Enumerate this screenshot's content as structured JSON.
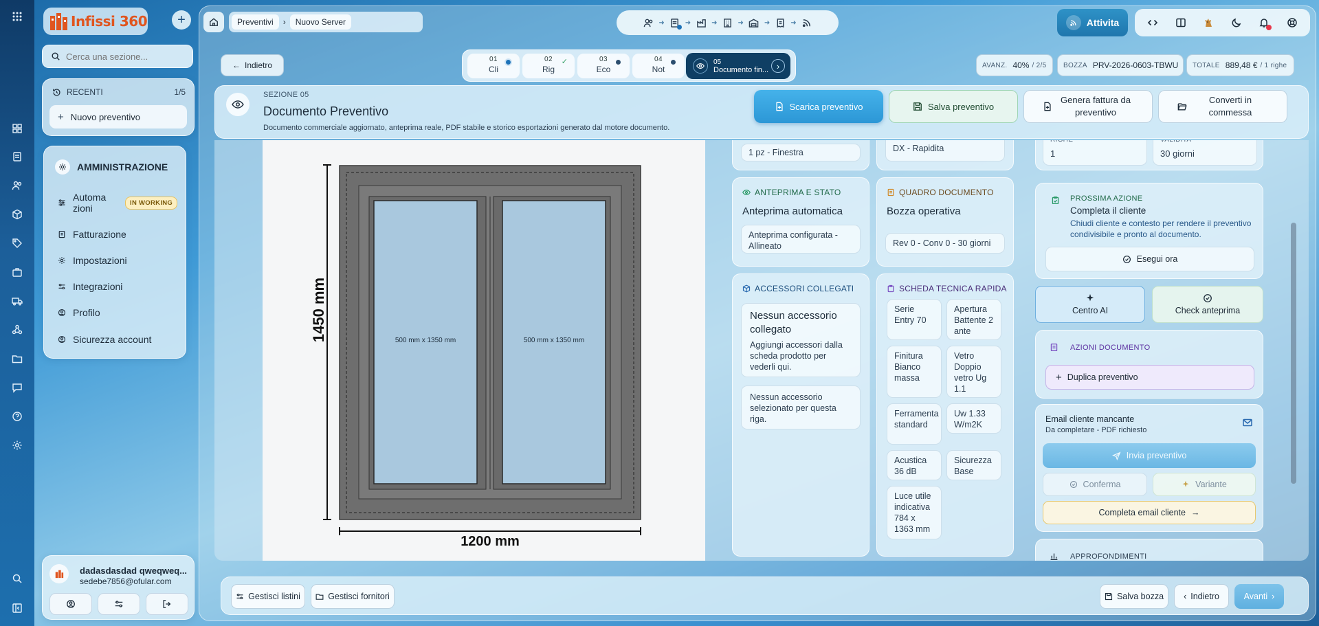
{
  "app": {
    "brand": "Infissi 360"
  },
  "sidebar": {
    "search_placeholder": "Cerca una sezione...",
    "recent": {
      "label": "RECENTI",
      "count": "1/5",
      "item": "Nuovo preventivo"
    },
    "admin": {
      "title": "AMMINISTRAZIONE",
      "items": [
        {
          "label": "Automa zioni",
          "badge": "IN WORKING"
        },
        {
          "label": "Fatturazione"
        },
        {
          "label": "Impostazioni"
        },
        {
          "label": "Integrazioni"
        },
        {
          "label": "Profilo"
        },
        {
          "label": "Sicurezza account"
        }
      ]
    },
    "user": {
      "name": "dadasdasdad qweqweq...",
      "email": "sedebe7856@ofular.com"
    }
  },
  "topbar": {
    "breadcrumbs": [
      "Preventivi",
      "Nuovo Server"
    ],
    "attiva_label": "Attivita"
  },
  "nav": {
    "back_label": "Indietro",
    "steps": [
      {
        "num": "01",
        "label": "Cli"
      },
      {
        "num": "02",
        "label": "Rig"
      },
      {
        "num": "03",
        "label": "Eco"
      },
      {
        "num": "04",
        "label": "Not"
      },
      {
        "num": "05",
        "label": "Documento fin..."
      }
    ],
    "stats": {
      "avanz_label": "AVANZ.",
      "avanz_value": "40%",
      "avanz_steps": "/ 2/5",
      "bozza_label": "BOZZA",
      "bozza_value": "PRV-2026-0603-TBWU",
      "totale_label": "TOTALE",
      "totale_value": "889,48 €",
      "totale_rows": "/ 1 righe"
    },
    "progress": 0.4
  },
  "section": {
    "eyebrow": "SEZIONE 05",
    "title": "Documento Preventivo",
    "subtitle": "Documento commerciale aggiornato, anteprima reale, PDF stabile e storico esportazioni generato dal motore documento.",
    "buttons": {
      "download": "Scarica preventivo",
      "save": "Salva preventivo",
      "invoice": "Genera fattura da preventivo",
      "convert": "Converti in commessa"
    }
  },
  "drawing": {
    "height_label": "1450 mm",
    "width_label": "1200 mm",
    "sash_left": "500 mm x 1350 mm",
    "sash_right": "500 mm x 1350 mm"
  },
  "cards": {
    "partial_left": "1 pz - Finestra",
    "partial_right": "Anta-ribalta SX / battente DX - Rapidita",
    "anteprima": {
      "title": "ANTEPRIMA E STATO",
      "main": "Anteprima automatica",
      "sub": "Anteprima configurata - Allineato"
    },
    "quadro": {
      "title": "QUADRO DOCUMENTO",
      "main": "Bozza operativa",
      "sub": "Rev 0 - Conv 0 - 30 giorni"
    },
    "accessori": {
      "title": "ACCESSORI COLLEGATI",
      "main": "Nessun accessorio collegato",
      "desc": "Aggiungi accessori dalla scheda prodotto per vederli qui.",
      "sub": "Nessun accessorio selezionato per questa riga."
    },
    "scheda": {
      "title": "SCHEDA TECNICA RAPIDA",
      "items": [
        "Serie Entry 70",
        "Apertura Battente 2 ante",
        "Finitura Bianco massa",
        "Vetro Doppio vetro Ug 1.1",
        "Ferramenta standard",
        "Uw 1.33 W/m2K",
        "Acustica 36 dB",
        "Sicurezza Base",
        "Luce utile indicativa 784 x 1363 mm"
      ]
    }
  },
  "right": {
    "righe_label": "RIGHE",
    "righe_value": "1",
    "validita_label": "VALIDITA",
    "validita_value": "30 giorni",
    "next": {
      "label": "PROSSIMA AZIONE",
      "title": "Completa il cliente",
      "desc": "Chiudi cliente e contesto per rendere il preventivo condivisibile e pronto al documento.",
      "button": "Esegui ora"
    },
    "centro_ai": "Centro AI",
    "check_anteprima": "Check anteprima",
    "azioni": {
      "label": "AZIONI DOCUMENTO",
      "duplica": "Duplica preventivo"
    },
    "email": {
      "title": "Email cliente mancante",
      "sub": "Da completare - PDF richiesto",
      "invia": "Invia preventivo",
      "conferma": "Conferma",
      "variante": "Variante",
      "completa": "Completa email cliente"
    },
    "approfondimenti": "APPROFONDIMENTI"
  },
  "bottom": {
    "gestisci_listini": "Gestisci listini",
    "gestisci_fornitori": "Gestisci fornitori",
    "salva_bozza": "Salva bozza",
    "indietro": "Indietro",
    "avanti": "Avanti"
  },
  "colors": {
    "accent": "#2c97d6",
    "dark_step": "#0f3f64",
    "brand": "#e0551f",
    "alert": "#e8374a"
  }
}
